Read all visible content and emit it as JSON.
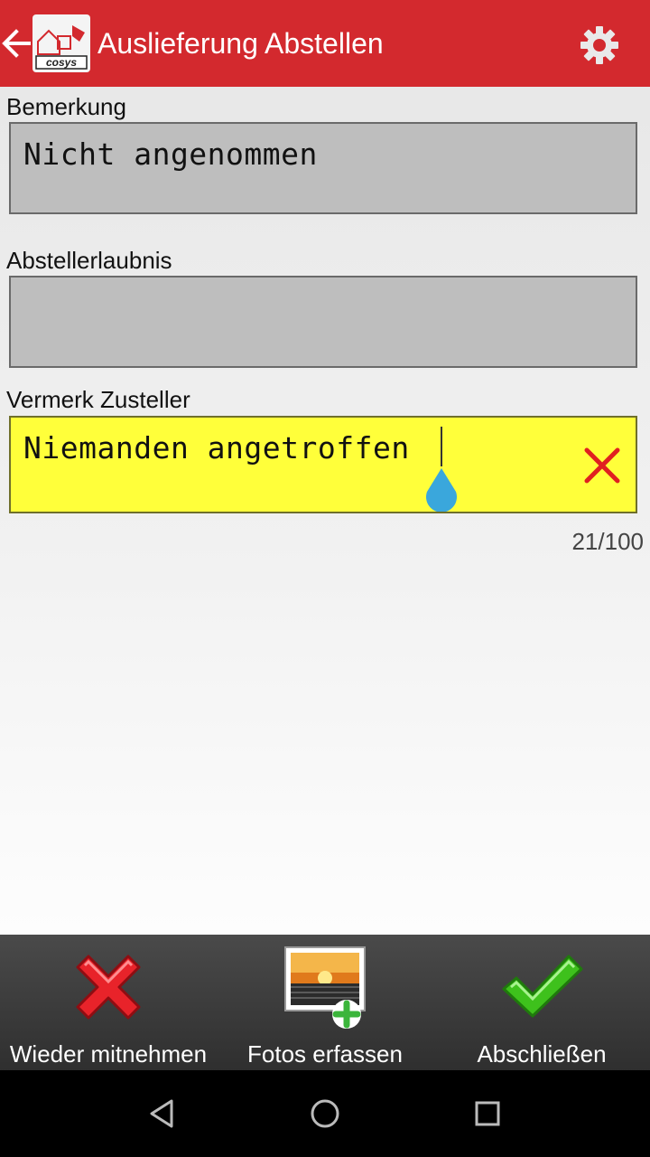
{
  "header": {
    "title": "Auslieferung Abstellen",
    "logo_text": "cosys",
    "brand_color": "#d3292e"
  },
  "form": {
    "bemerkung": {
      "label": "Bemerkung",
      "value": "Nicht angenommen"
    },
    "abstellerlaubnis": {
      "label": "Abstellerlaubnis",
      "value": ""
    },
    "vermerk": {
      "label": "Vermerk Zusteller",
      "value": "Niemanden angetroffen",
      "counter": "21/100",
      "highlight_color": "#ffff3a"
    }
  },
  "actions": {
    "cancel": {
      "label": "Wieder mitnehmen",
      "icon": "red-x-icon"
    },
    "photos": {
      "label": "Fotos erfassen",
      "icon": "add-photo-icon"
    },
    "finish": {
      "label": "Abschließen",
      "icon": "green-check-icon"
    }
  },
  "system_nav": {
    "back": "back-triangle-icon",
    "home": "home-circle-icon",
    "recents": "recents-square-icon"
  }
}
